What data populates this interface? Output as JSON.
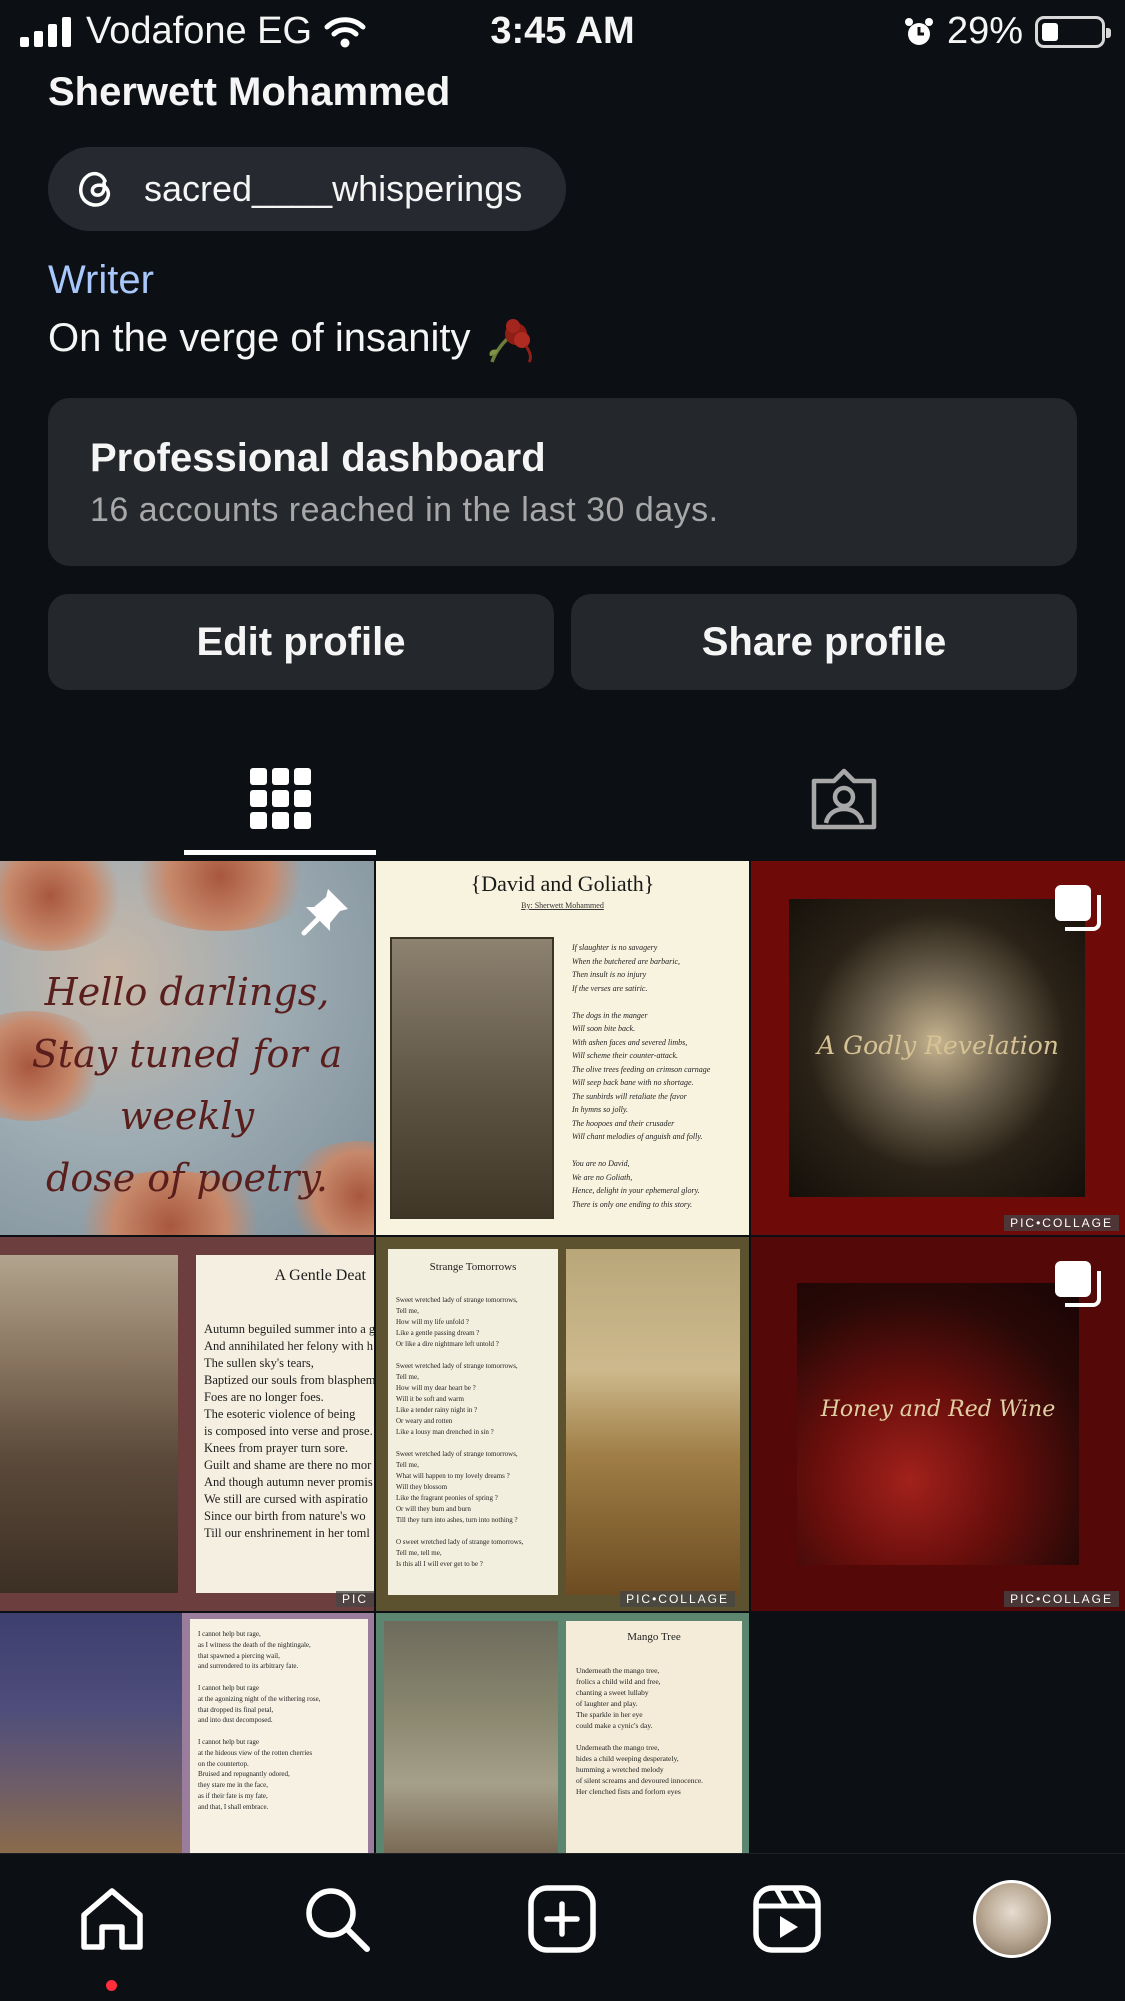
{
  "status_bar": {
    "carrier": "Vodafone EG",
    "time": "3:45 AM",
    "battery_percent": "29%",
    "battery_level": 0.29,
    "icons": [
      "cellular-signal-icon",
      "wifi-icon",
      "alarm-icon",
      "battery-icon"
    ]
  },
  "profile": {
    "name": "Sherwett Mohammed",
    "threads_handle": "sacred____whisperings",
    "category": "Writer",
    "bio": "On the verge of insanity",
    "bio_emoji_icon": "wilted-rose-icon"
  },
  "dashboard": {
    "title": "Professional dashboard",
    "subtitle": "16 accounts reached in the last 30 days."
  },
  "buttons": {
    "edit": "Edit profile",
    "share": "Share profile"
  },
  "tabs": [
    {
      "icon": "grid-icon",
      "active": true
    },
    {
      "icon": "tagged-icon",
      "active": false
    }
  ],
  "posts": [
    {
      "lines": [
        "Hello darlings,",
        "Stay tuned for a weekly",
        "dose of poetry."
      ],
      "badge_icon": "pin-icon"
    },
    {
      "title": "{David and Goliath}",
      "byline": "By: Sherwett Mohammed",
      "poem": "If slaughter is no savagery\nWhen the butchered are barbaric,\nThen insult is no injury\nIf the verses are satiric.\n\nThe dogs in the manger\nWill soon bite back.\nWith ashen faces and severed limbs,\nWill scheme their counter-attack.\nThe olive trees feeding on crimson carnage\nWill seep back bane with no shortage.\nThe sunbirds will retaliate the favor\nIn hymns so jolly.\nThe hoopoes and their crusader\nWill chant melodies of anguish and folly.\n\nYou are no David,\nWe are no Goliath,\nHence, delight in your ephemeral glory.\nThere is only one ending to this story."
    },
    {
      "text": "A Godly Revelation",
      "watermark": "PIC•COLLAGE",
      "badge_icon": "carousel-icon"
    },
    {
      "title": "A Gentle Deat",
      "lines": [
        "Autumn beguiled summer into a g",
        "And annihilated her felony with h",
        "The sullen sky's tears,",
        "Baptized our souls from blasphem",
        "Foes are no longer foes.",
        "The esoteric violence of being",
        "is composed into verse and prose.",
        "Knees from prayer turn sore.",
        "Guilt and shame are there no mor",
        "And though autumn never promis",
        "We still are cursed with aspiratio",
        "Since our birth from nature's wo",
        "Till our enshrinement in her toml"
      ],
      "watermark": "PIC"
    },
    {
      "title": "Strange Tomorrows",
      "lines": [
        "Sweet wretched lady of strange tomorrows,",
        "Tell me,",
        "How will my life unfold ?",
        "Like a gentle passing dream ?",
        "Or like a dire nightmare left untold ?",
        "",
        "Sweet wretched lady of strange tomorrows,",
        "Tell me,",
        "How will my dear heart be ?",
        "Will it be soft and warm",
        "Like a tender rainy night in ?",
        "Or weary and rotten",
        "Like a lousy man drenched in sin ?",
        "",
        "Sweet wretched lady of strange tomorrows,",
        "Tell me,",
        "What will happen to my lovely dreams ?",
        "Will they blossom",
        "Like the fragrant peonies of spring ?",
        "Or will they burn and burn",
        "Till they turn into ashes, turn into nothing ?",
        "",
        "O sweet wretched lady of strange tomorrows,",
        "Tell me, tell me,",
        "Is this all I will ever get to be ?"
      ],
      "watermark": "PIC•COLLAGE"
    },
    {
      "text": "Honey and Red Wine",
      "watermark": "PIC•COLLAGE",
      "badge_icon": "carousel-icon"
    },
    {
      "lines": [
        "I cannot help but rage,",
        "as I witness the death of the nightingale,",
        "that spawned a piercing wail,",
        "and surrendered to its arbitrary fate.",
        "",
        "I cannot help but rage",
        "at the agonizing night of the withering rose,",
        "that dropped its final petal,",
        "and into dust decomposed.",
        "",
        "I cannot help but rage",
        "at the hideous view of the rotten cherries",
        "on the countertop.",
        "Bruised and repugnantly odored,",
        "they stare me in the face,",
        "as if their fate is my fate,",
        "and that, I shall embrace."
      ]
    },
    {
      "title": "Mango Tree",
      "lines": [
        "Underneath the mango tree,",
        "frolics a child wild and free,",
        "chanting a sweet lullaby",
        "of laughter and play.",
        "The sparkle in her eye",
        "could make a cynic's day.",
        "",
        "Underneath the mango tree,",
        "hides a child weeping desperately,",
        "humming a wretched melody",
        "of silent screams and devoured innocence.",
        "Her clenched fists and forlorn eyes"
      ]
    }
  ],
  "bottom_nav": [
    {
      "icon": "home-icon",
      "active": true
    },
    {
      "icon": "search-icon"
    },
    {
      "icon": "create-post-icon"
    },
    {
      "icon": "reels-icon"
    },
    {
      "icon": "profile-avatar"
    }
  ],
  "colors": {
    "background": "#0c1014",
    "card": "#24272c",
    "category_link": "#a8c7fa",
    "notification_dot": "#ff2e3d"
  }
}
